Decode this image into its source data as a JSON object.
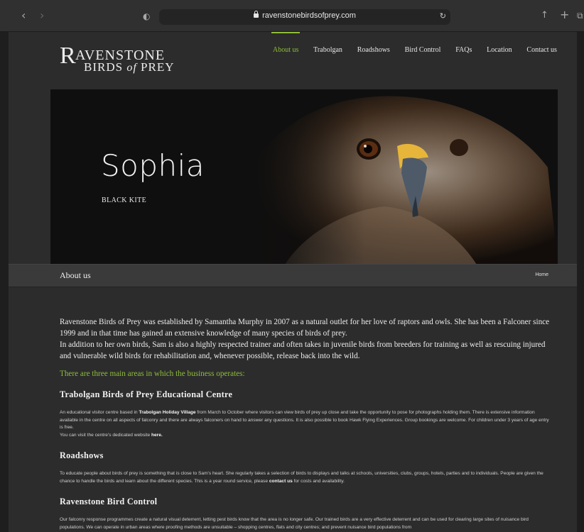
{
  "browser": {
    "url": "ravenstonebirdsofprey.com",
    "icons": [
      "back-icon",
      "forward-icon",
      "shield-icon",
      "lock-icon",
      "reload-icon",
      "share-icon",
      "new-tab-icon",
      "tabs-icon"
    ]
  },
  "site": {
    "logo_line1": "AVENSTONE",
    "logo_initial": "R",
    "logo_line2_a": "BIRDS ",
    "logo_line2_of": "of",
    "logo_line2_b": " PREY",
    "accent": "#8fbd3a",
    "nav": [
      "About us",
      "Trabolgan",
      "Roadshows",
      "Bird Control",
      "FAQs",
      "Location",
      "Contact us"
    ],
    "active_nav": "About us"
  },
  "hero": {
    "title": "Sophia",
    "subtitle": "BLACK KITE"
  },
  "breadcrumb": {
    "title": "About us",
    "home": "Home"
  },
  "content": {
    "intro_1": "Ravenstone Birds of Prey was established by Samantha Murphy in 2007 as a natural outlet for her love of raptors and owls. She has been a Falconer since 1999 and in that time has gained an extensive knowledge of many species of birds of prey.",
    "intro_2": "In addition to her own birds, Sam is also a highly respected trainer and often takes in juvenile birds from breeders for training as well as rescuing injured and vulnerable wild birds for rehabilitation and, whenever possible, release back into the wild.",
    "lead": "There are three main areas in which the business operates:",
    "s1_title": "Trabolgan Birds of Prey Educational Centre",
    "s1_a": "An educational visitor centre based in ",
    "s1_link": "Trabolgan Holiday Village",
    "s1_b": " from March to October where visitors can view birds of prey up close and take the opportunity to pose for photographs holding them. There is extensive information available in the centre on all aspects of falconry and there are always falconers on hand to answer any questions. It is also possible to book Hawk Flying Experiences. Group bookings are welcome. For children under 3 years of age entry is free.",
    "s1_c": "You can visit the centre's dedicated website ",
    "s1_here": "here.",
    "s2_title": "Roadshows",
    "s2_a": "To educate people about birds of prey is something that is close to Sam's heart. She regularly takes a selection of birds to displays and talks at schools, universities, clubs, groups, hotels, parties and to individuals. People are given the chance to handle the birds and learn about the different species. This is a year round service, please ",
    "s2_link": "contact us",
    "s2_b": " for costs and availability.",
    "s3_title": "Ravenstone Bird Control",
    "s3_a": "Our falconry response programmes create a natural visual deterrent, letting pest birds know that the area is no longer safe. Our trained birds are a very effective deterrent and can be used for clearing large sites of nuisance bird populations. We can operate in urban areas where proofing methods are unsuitable – shopping centres, flats and city centres; and prevent nuisance bird populations from"
  }
}
